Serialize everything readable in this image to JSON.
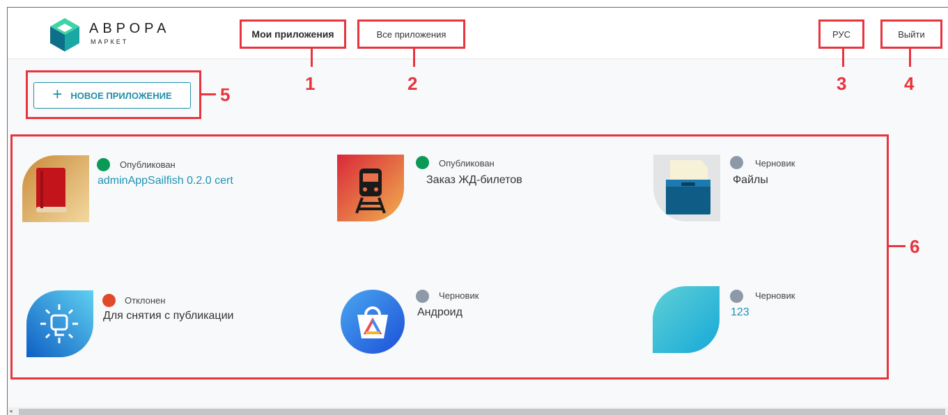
{
  "logo": {
    "title": "АВРОРА",
    "subtitle": "МАРКЕТ"
  },
  "nav": {
    "my_apps": "Мои приложения",
    "all_apps": "Все приложения",
    "language": "РУС",
    "logout": "Выйти"
  },
  "toolbar": {
    "new_app_label": "НОВОЕ ПРИЛОЖЕНИЕ"
  },
  "annotations": [
    "1",
    "2",
    "3",
    "4",
    "5",
    "6"
  ],
  "apps": [
    {
      "status": "Опубликован",
      "status_color": "#0a9a55",
      "name": "adminAppSailfish 0.2.0 cert",
      "icon": "book-icon"
    },
    {
      "status": "Опубликован",
      "status_color": "#0a9a55",
      "name": "Заказ ЖД-билетов",
      "icon": "train-icon"
    },
    {
      "status": "Черновик",
      "status_color": "#8e99a8",
      "name": "Файлы",
      "icon": "folder-icon"
    },
    {
      "status": "Отклонен",
      "status_color": "#e04a2a",
      "name": "Для снятия с публикации",
      "icon": "sun-icon"
    },
    {
      "status": "Черновик",
      "status_color": "#8e99a8",
      "name": "Андроид",
      "icon": "app-store-icon"
    },
    {
      "status": "Черновик",
      "status_color": "#8e99a8",
      "name": "123",
      "icon": "leaf-placeholder-icon"
    }
  ],
  "colors": {
    "accent": "#1d93b3",
    "annotation": "#e8343d"
  }
}
